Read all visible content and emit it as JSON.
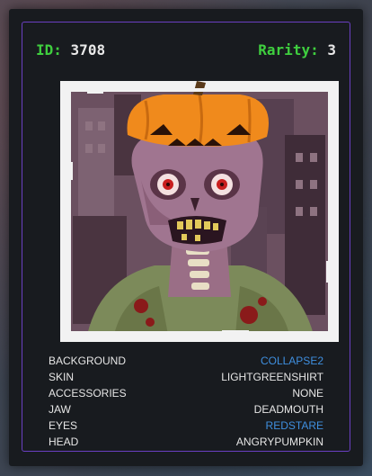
{
  "card": {
    "id_label": "ID:",
    "id_value": "3708",
    "rarity_label": "Rarity:",
    "rarity_value": "3"
  },
  "artwork": {
    "subject_icon": "zombie-pumpkin-head-portrait"
  },
  "traits": [
    {
      "name": "BACKGROUND",
      "value": "COLLAPSE2",
      "highlight": true
    },
    {
      "name": "SKIN",
      "value": "LIGHTGREENSHIRT",
      "highlight": false
    },
    {
      "name": "ACCESSORIES",
      "value": "NONE",
      "highlight": false
    },
    {
      "name": "JAW",
      "value": "DEADMOUTH",
      "highlight": false
    },
    {
      "name": "EYES",
      "value": "REDSTARE",
      "highlight": true
    },
    {
      "name": "HEAD",
      "value": "ANGRYPUMPKIN",
      "highlight": false
    }
  ],
  "colors": {
    "label_green": "#3fcf3f",
    "link_blue": "#3f8fdf",
    "border_purple": "#6a3fc2",
    "card_bg": "#181b1f"
  }
}
